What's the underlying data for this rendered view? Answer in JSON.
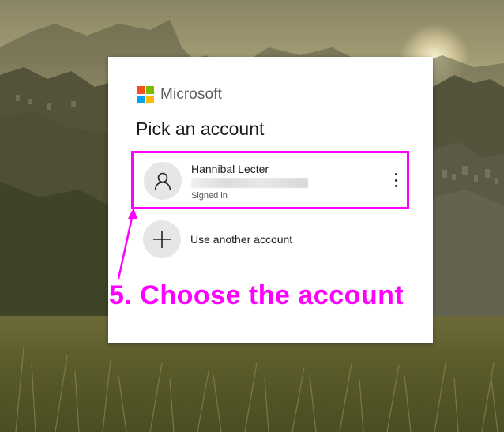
{
  "brand": {
    "name": "Microsoft",
    "colors": {
      "red": "#f25022",
      "green": "#7fba00",
      "blue": "#00a4ef",
      "yellow": "#ffb900"
    }
  },
  "dialog": {
    "title": "Pick an account",
    "accounts": [
      {
        "name": "Hannibal Lecter",
        "status": "Signed in",
        "avatar_icon": "person-icon",
        "menu_icon": "more-vertical-icon"
      }
    ],
    "use_another": {
      "label": "Use another account",
      "icon": "plus-icon"
    }
  },
  "annotation": {
    "text": "5. Choose the account",
    "color": "#ff00ff"
  }
}
